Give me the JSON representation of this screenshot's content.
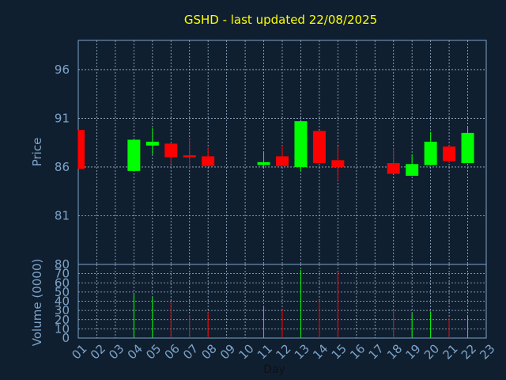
{
  "chart_data": {
    "type": "candlestick",
    "title": "GSHD - last updated 22/08/2025",
    "xlabel": "Day",
    "price": {
      "ylabel": "Price",
      "ylim": [
        76,
        99
      ],
      "yticks": [
        81,
        86,
        91,
        96
      ],
      "grid": true
    },
    "volume": {
      "ylabel": "Volume (0000)",
      "ylim": [
        0,
        80
      ],
      "yticks": [
        0,
        10,
        20,
        30,
        40,
        50,
        60,
        70,
        80
      ],
      "grid": true
    },
    "categories": [
      "01",
      "02",
      "03",
      "04",
      "05",
      "06",
      "07",
      "08",
      "09",
      "10",
      "11",
      "12",
      "13",
      "14",
      "15",
      "16",
      "17",
      "18",
      "19",
      "20",
      "21",
      "22",
      "23"
    ],
    "candles": [
      {
        "day": "01",
        "open": 89.8,
        "close": 85.8,
        "high": 89.8,
        "low": 85.8,
        "volume": 0
      },
      {
        "day": "04",
        "open": 85.6,
        "close": 88.8,
        "high": 88.8,
        "low": 85.6,
        "volume": 49
      },
      {
        "day": "05",
        "open": 88.2,
        "close": 88.6,
        "high": 90.0,
        "low": 87.3,
        "volume": 45
      },
      {
        "day": "06",
        "open": 88.4,
        "close": 87.0,
        "high": 88.5,
        "low": 86.3,
        "volume": 39
      },
      {
        "day": "07",
        "open": 87.2,
        "close": 87.0,
        "high": 89.0,
        "low": 85.9,
        "volume": 25
      },
      {
        "day": "08",
        "open": 87.1,
        "close": 86.1,
        "high": 88.0,
        "low": 86.1,
        "volume": 28
      },
      {
        "day": "11",
        "open": 86.2,
        "close": 86.5,
        "high": 87.5,
        "low": 85.9,
        "volume": 35
      },
      {
        "day": "12",
        "open": 87.1,
        "close": 86.1,
        "high": 88.2,
        "low": 86.1,
        "volume": 31
      },
      {
        "day": "13",
        "open": 86.0,
        "close": 90.7,
        "high": 90.7,
        "low": 85.5,
        "volume": 74
      },
      {
        "day": "14",
        "open": 89.7,
        "close": 86.4,
        "high": 89.7,
        "low": 86.4,
        "volume": 41
      },
      {
        "day": "15",
        "open": 86.7,
        "close": 86.0,
        "high": 88.1,
        "low": 84.6,
        "volume": 72
      },
      {
        "day": "18",
        "open": 86.4,
        "close": 85.3,
        "high": 87.9,
        "low": 85.3,
        "volume": 31
      },
      {
        "day": "19",
        "open": 85.1,
        "close": 86.3,
        "high": 87.3,
        "low": 85.1,
        "volume": 27
      },
      {
        "day": "20",
        "open": 86.2,
        "close": 88.6,
        "high": 89.6,
        "low": 86.2,
        "volume": 29
      },
      {
        "day": "21",
        "open": 88.1,
        "close": 86.6,
        "high": 88.2,
        "low": 86.4,
        "volume": 22
      },
      {
        "day": "22",
        "open": 86.4,
        "close": 89.5,
        "high": 90.1,
        "low": 86.4,
        "volume": 25
      }
    ],
    "colors": {
      "up": "#00ff00",
      "down": "#ff0000",
      "background": "#0f1f30",
      "axis_text": "#7ea3c7",
      "title": "#ffff00",
      "grid": "#9fb8d0",
      "day_text": "#111111"
    }
  }
}
